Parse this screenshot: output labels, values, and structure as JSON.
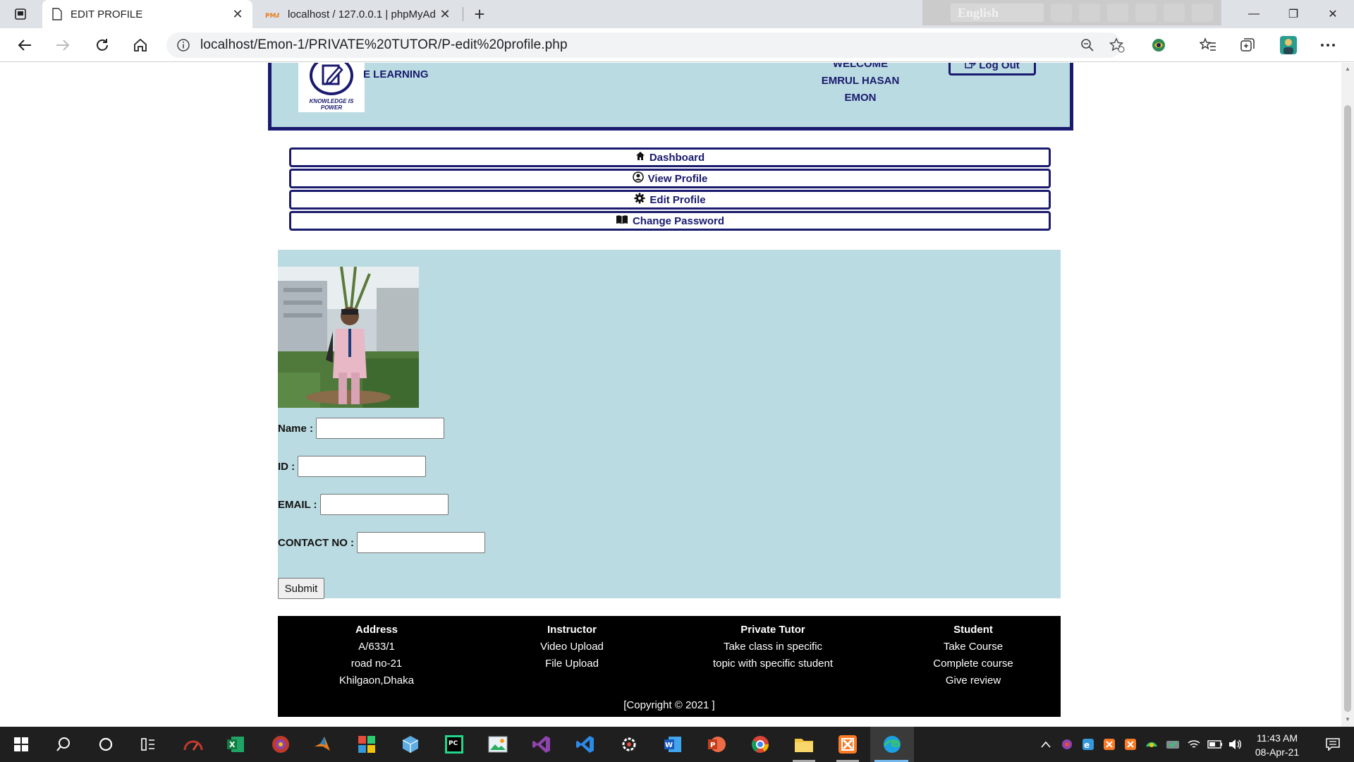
{
  "browser": {
    "tabs": [
      {
        "title": "EDIT PROFILE",
        "active": true
      },
      {
        "title": "localhost / 127.0.0.1 | phpMyAdr",
        "active": false
      }
    ],
    "url": "localhost/Emon-1/PRIVATE%20TUTOR/P-edit%20profile.php",
    "translate_language": "English"
  },
  "header": {
    "logo_tagline": "KNOWLEDGE IS POWER",
    "brand": "E LEARNING",
    "welcome_line1": "WELCOME",
    "welcome_line2": "EMRUL HASAN",
    "welcome_line3": "EMON",
    "logout_label": "Log Out"
  },
  "menu": {
    "dashboard": "Dashboard",
    "view_profile": "View Profile",
    "edit_profile": "Edit Profile",
    "change_password": "Change Password"
  },
  "form": {
    "name_label": "Name :",
    "id_label": "ID :",
    "email_label": "EMAIL :",
    "contact_label": "CONTACT NO :",
    "name_value": "",
    "id_value": "",
    "email_value": "",
    "contact_value": "",
    "submit_label": "Submit"
  },
  "footer": {
    "address": {
      "heading": "Address",
      "lines": [
        "A/633/1",
        "road no-21",
        "Khilgaon,Dhaka"
      ]
    },
    "instructor": {
      "heading": "Instructor",
      "lines": [
        "Video Upload",
        "File Upload"
      ]
    },
    "tutor": {
      "heading": "Private Tutor",
      "lines": [
        "Take class in specific",
        "topic with specific student"
      ]
    },
    "student": {
      "heading": "Student",
      "lines": [
        "Take Course",
        "Complete course",
        "Give review"
      ]
    },
    "copyright": "[Copyright © 2021 ]"
  },
  "taskbar": {
    "time": "11:43 AM",
    "date": "08-Apr-21"
  },
  "colors": {
    "header_bg": "#badbe1",
    "accent": "#1a1a6e",
    "footer_bg": "#000000",
    "taskbar_bg": "#1f1f1f"
  },
  "icons": [
    "tab-actions-icon",
    "page-icon",
    "close-icon",
    "phpmyadmin-icon",
    "new-tab-icon",
    "back-icon",
    "forward-icon",
    "refresh-icon",
    "home-icon",
    "info-icon",
    "zoom-icon",
    "favorite-add-icon",
    "extension-icon",
    "favorites-icon",
    "collections-icon",
    "profile-icon",
    "more-icon",
    "logout-icon",
    "home-icon",
    "user-circle-icon",
    "gear-icon",
    "book-icon",
    "windows-icon",
    "search-icon",
    "cortana-icon",
    "task-view-icon",
    "notifications-icon"
  ]
}
